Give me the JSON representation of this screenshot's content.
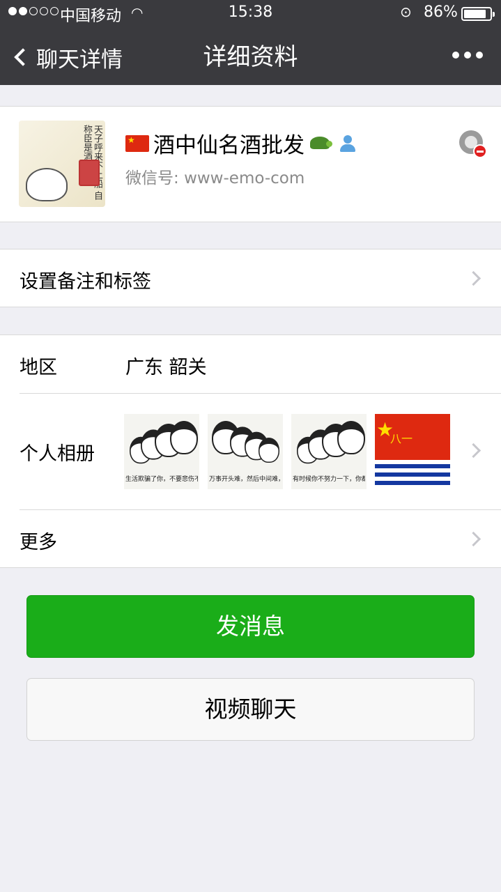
{
  "status_bar": {
    "signal_dots_filled": 2,
    "signal_dots_total": 5,
    "carrier": "中国移动",
    "time": "15:38",
    "battery_percent": "86%",
    "battery_level": 0.86
  },
  "nav": {
    "back_label": "聊天详情",
    "title": "详细资料"
  },
  "profile": {
    "name": "酒中仙名酒批发",
    "wechat_id_label": "微信号:",
    "wechat_id": "www-emo-com",
    "avatar_text": "天子呼来不上船 自称臣是酒中仙"
  },
  "remark": {
    "label": "设置备注和标签"
  },
  "details": {
    "region_label": "地区",
    "region_value": "广东  韶关",
    "album_label": "个人相册",
    "album_captions": [
      "生活欺骗了你，不要悲伤不要心急，反正明天也一样",
      "万事开头难，然后中间难，最后结尾难。",
      "有时候你不努力一下，你都不知道什么叫绝望",
      ""
    ],
    "album_flag_text": "八一",
    "more_label": "更多"
  },
  "buttons": {
    "send_message": "发消息",
    "video_chat": "视频聊天"
  },
  "colors": {
    "nav_bg": "#3a3a3e",
    "page_bg": "#efeff4",
    "primary_green": "#1aad19"
  }
}
